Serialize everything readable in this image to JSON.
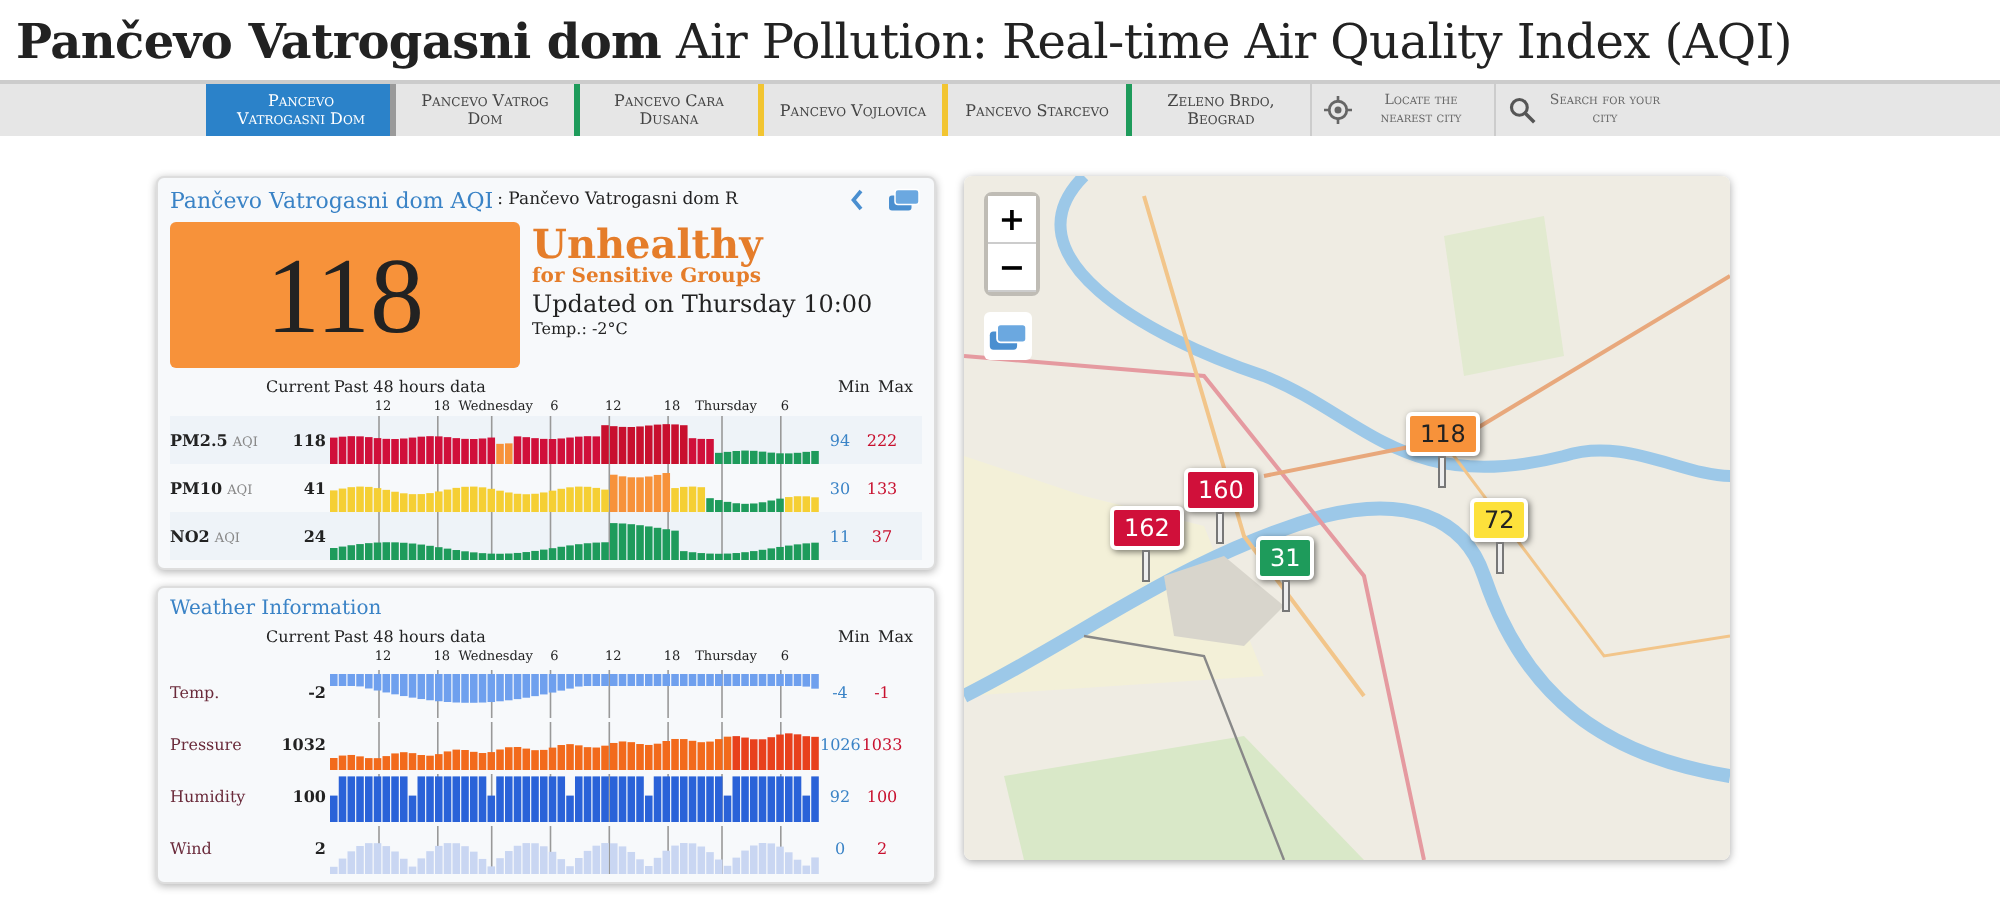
{
  "page_title": {
    "bold": "Pančevo Vatrogasni dom",
    "rest": "Air Pollution: Real-time Air Quality Index (AQI)"
  },
  "nav": [
    {
      "kind": "station",
      "label": "Pancevo Vatrogasni Dom",
      "selected": true,
      "color": "#2b82c9"
    },
    {
      "kind": "station",
      "label": "Pancevo Vatrog Dom",
      "selected": false,
      "color": "#9a9a9a"
    },
    {
      "kind": "station",
      "label": "Pancevo Cara Dusana",
      "selected": false,
      "color": "#1e9b5b"
    },
    {
      "kind": "station",
      "label": "Pancevo Vojlovica",
      "selected": false,
      "color": "#f2c531"
    },
    {
      "kind": "station",
      "label": "Pancevo Starcevo",
      "selected": false,
      "color": "#f2c531"
    },
    {
      "kind": "station",
      "label": "Zeleno Brdo, Beograd",
      "selected": false,
      "color": "#1e9b5b"
    },
    {
      "kind": "locate",
      "label": "Locate the nearest city",
      "selected": false
    },
    {
      "kind": "search",
      "label": "Search for your city",
      "selected": false
    }
  ],
  "aqi_card": {
    "station_link": "Pančevo Vatrogasni dom AQI",
    "station_name": ": Pančevo Vatrogasni dom R",
    "aqi": "118",
    "level": "Unhealthy",
    "level_sub": "for Sensitive Groups",
    "updated": "Updated on Thursday 10:00",
    "temp": "Temp.: -2°C",
    "header": {
      "current": "Current",
      "past": "Past 48 hours data",
      "min": "Min",
      "max": "Max"
    },
    "ticks": [
      "12",
      "18",
      "Wednesday",
      "6",
      "12",
      "18",
      "Thursday",
      "6"
    ],
    "rows": [
      {
        "kind": "aqi",
        "name": "PM2.5",
        "unit": "AQI",
        "current": "118",
        "min": "94",
        "max": "222"
      },
      {
        "kind": "aqi",
        "name": "PM10",
        "unit": "AQI",
        "current": "41",
        "min": "30",
        "max": "133"
      },
      {
        "kind": "aqi",
        "name": "NO2",
        "unit": "AQI",
        "current": "24",
        "min": "11",
        "max": "37"
      }
    ]
  },
  "weather_card": {
    "title": "Weather Information",
    "header": {
      "current": "Current",
      "past": "Past 48 hours data",
      "min": "Min",
      "max": "Max"
    },
    "ticks": [
      "12",
      "18",
      "Wednesday",
      "6",
      "12",
      "18",
      "Thursday",
      "6"
    ],
    "rows": [
      {
        "kind": "temp",
        "name": "Temp.",
        "current": "-2",
        "min": "-4",
        "max": "-1"
      },
      {
        "kind": "pressure",
        "name": "Pressure",
        "current": "1032",
        "min": "1026",
        "max": "1033"
      },
      {
        "kind": "humidity",
        "name": "Humidity",
        "current": "100",
        "min": "92",
        "max": "100"
      },
      {
        "kind": "wind",
        "name": "Wind",
        "current": "2",
        "min": "0",
        "max": "2"
      }
    ]
  },
  "map": {
    "zoom_in": "+",
    "zoom_out": "−",
    "markers": [
      {
        "value": "162",
        "color": "#d0103a"
      },
      {
        "value": "160",
        "color": "#d0103a"
      },
      {
        "value": "31",
        "color": "#1e9b5b"
      },
      {
        "value": "118",
        "color": "#f7923a"
      },
      {
        "value": "72",
        "color": "#fde13b"
      }
    ]
  }
}
